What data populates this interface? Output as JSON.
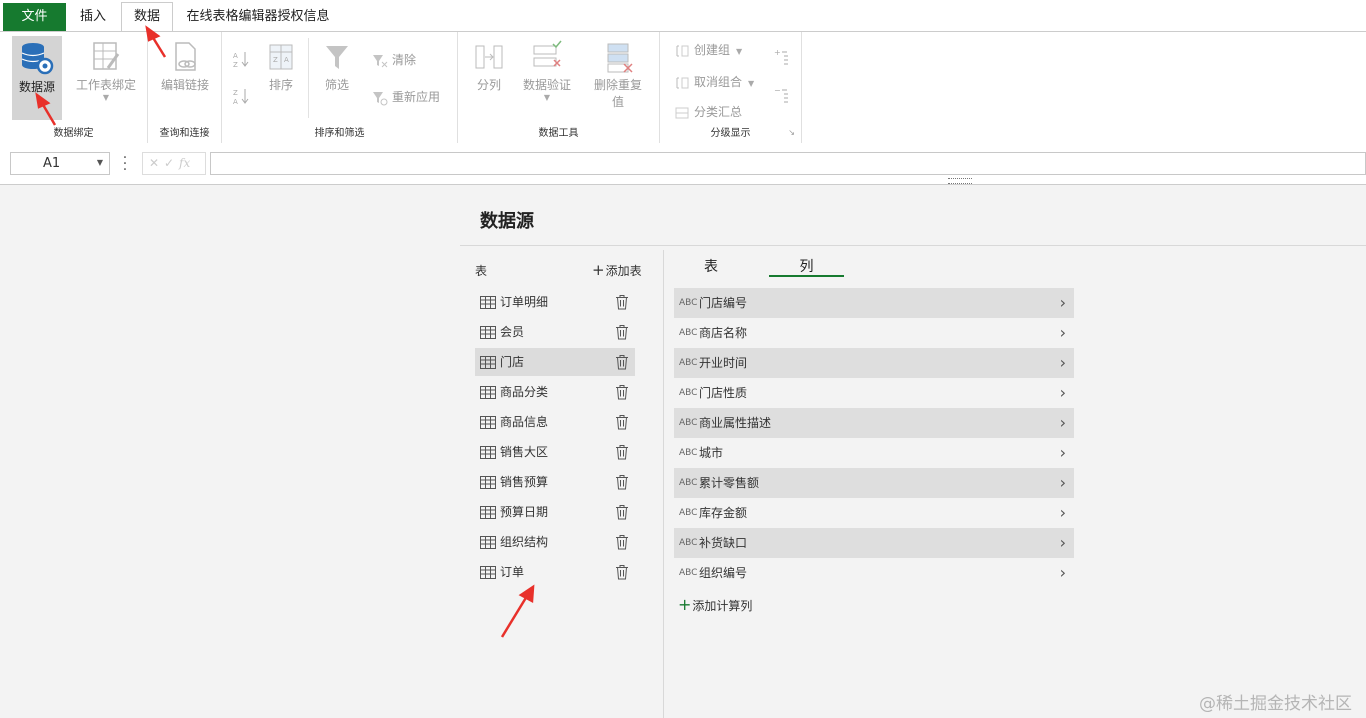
{
  "tabs": {
    "file": "文件",
    "insert": "插入",
    "data": "数据",
    "license": "在线表格编辑器授权信息"
  },
  "ribbon": {
    "groups": {
      "data_binding": "数据绑定",
      "query_connect": "查询和连接",
      "sort_filter": "排序和筛选",
      "data_tools": "数据工具",
      "outline": "分级显示"
    },
    "data_source": "数据源",
    "sheet_binding": "工作表绑定",
    "edit_links": "编辑链接",
    "sort": "排序",
    "filter": "筛选",
    "clear": "清除",
    "reapply": "重新应用",
    "text_to_columns": "分列",
    "data_validation": "数据验证",
    "remove_duplicates_line1": "删除重复",
    "remove_duplicates_line2": "值",
    "group": "创建组",
    "ungroup": "取消组合",
    "subtotal": "分类汇总"
  },
  "formula_bar": {
    "cell_ref": "A1",
    "fx": "fx",
    "formula": ""
  },
  "panel": {
    "title": "数据源",
    "tables_label": "表",
    "add_table": "添加表",
    "tables": [
      {
        "name": "订单明细"
      },
      {
        "name": "会员"
      },
      {
        "name": "门店"
      },
      {
        "name": "商品分类"
      },
      {
        "name": "商品信息"
      },
      {
        "name": "销售大区"
      },
      {
        "name": "销售预算"
      },
      {
        "name": "预算日期"
      },
      {
        "name": "组织结构"
      },
      {
        "name": "订单"
      }
    ],
    "selected_table": "门店",
    "col_tabs": {
      "table": "表",
      "columns": "列"
    },
    "active_col_tab": "列",
    "column_type": "ABC",
    "columns": [
      {
        "name": "门店编号"
      },
      {
        "name": "商店名称"
      },
      {
        "name": "开业时间"
      },
      {
        "name": "门店性质"
      },
      {
        "name": "商业属性描述"
      },
      {
        "name": "城市"
      },
      {
        "name": "累计零售额"
      },
      {
        "name": "库存金额"
      },
      {
        "name": "补货缺口"
      },
      {
        "name": "组织编号"
      }
    ],
    "add_calc_column": "添加计算列"
  },
  "watermark": "@稀土掘金技术社区",
  "colors": {
    "accent": "#167a2f",
    "annotation_arrow": "#e8302a"
  }
}
